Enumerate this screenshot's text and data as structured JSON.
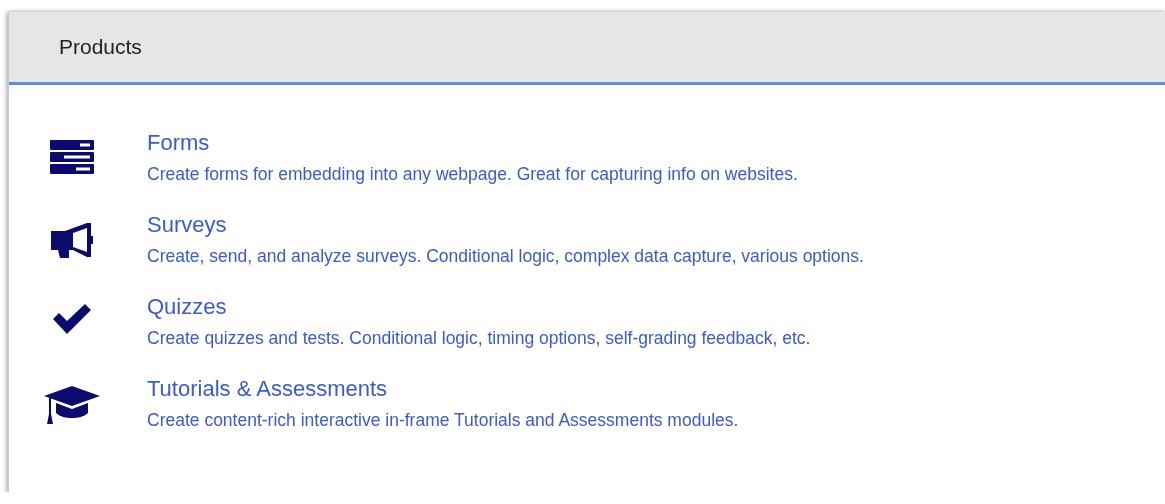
{
  "panel": {
    "title": "Products"
  },
  "products": [
    {
      "kind": "forms",
      "name": "Forms",
      "description": "Create forms for embedding into any webpage. Great for capturing info on websites."
    },
    {
      "kind": "surveys",
      "name": "Surveys",
      "description": "Create, send, and analyze surveys. Conditional logic, complex data capture, various options."
    },
    {
      "kind": "quizzes",
      "name": "Quizzes",
      "description": "Create quizzes and tests. Conditional logic, timing options, self-grading feedback, etc."
    },
    {
      "kind": "tutorials",
      "name": "Tutorials & Assessments",
      "description": "Create content-rich interactive in-frame Tutorials and Assessments modules."
    }
  ]
}
